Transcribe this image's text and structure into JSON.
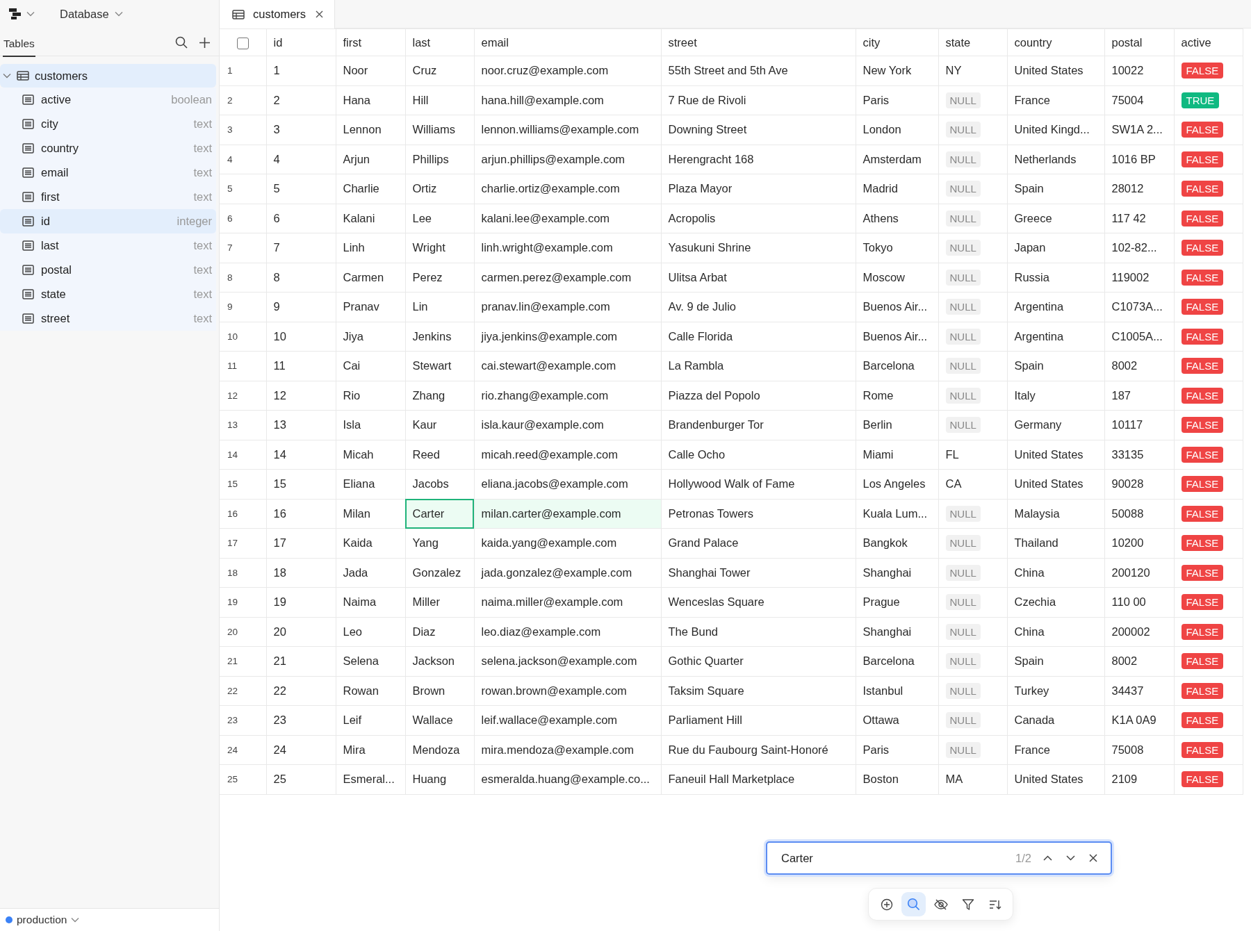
{
  "app": {
    "database_menu": "Database"
  },
  "sidebar": {
    "tabs": [
      {
        "label": "Tables",
        "selected": true
      }
    ],
    "tree": [
      {
        "name": "customers",
        "expanded": true,
        "selected": true,
        "children": [
          {
            "name": "active",
            "type": "boolean",
            "selected": false
          },
          {
            "name": "city",
            "type": "text",
            "selected": false
          },
          {
            "name": "country",
            "type": "text",
            "selected": false
          },
          {
            "name": "email",
            "type": "text",
            "selected": false
          },
          {
            "name": "first",
            "type": "text",
            "selected": false
          },
          {
            "name": "id",
            "type": "integer",
            "selected": true
          },
          {
            "name": "last",
            "type": "text",
            "selected": false
          },
          {
            "name": "postal",
            "type": "text",
            "selected": false
          },
          {
            "name": "state",
            "type": "text",
            "selected": false
          },
          {
            "name": "street",
            "type": "text",
            "selected": false
          }
        ]
      }
    ],
    "connection": {
      "name": "production",
      "color": "#3b82f6"
    }
  },
  "tabs": [
    {
      "label": "customers",
      "selected": true
    }
  ],
  "table": {
    "select_all": {
      "checked": false
    },
    "columns": [
      "id",
      "first",
      "last",
      "email",
      "street",
      "city",
      "state",
      "country",
      "postal",
      "active"
    ],
    "rows": [
      {
        "number": "1",
        "cells": [
          "1",
          "Noor",
          "Cruz",
          "noor.cruz@example.com",
          "55th Street and 5th Ave",
          "New York",
          "NY",
          "United States",
          "10022"
        ],
        "state_null": false,
        "active": {
          "label": "FALSE",
          "value": false
        }
      },
      {
        "number": "2",
        "cells": [
          "2",
          "Hana",
          "Hill",
          "hana.hill@example.com",
          "7 Rue de Rivoli",
          "Paris",
          "NULL",
          "France",
          "75004"
        ],
        "state_null": true,
        "active": {
          "label": "TRUE",
          "value": true
        }
      },
      {
        "number": "3",
        "cells": [
          "3",
          "Lennon",
          "Williams",
          "lennon.williams@example.com",
          "Downing Street",
          "London",
          "NULL",
          "United Kingd...",
          "SW1A 2..."
        ],
        "state_null": true,
        "active": {
          "label": "FALSE",
          "value": false
        }
      },
      {
        "number": "4",
        "cells": [
          "4",
          "Arjun",
          "Phillips",
          "arjun.phillips@example.com",
          "Herengracht 168",
          "Amsterdam",
          "NULL",
          "Netherlands",
          "1016 BP"
        ],
        "state_null": true,
        "active": {
          "label": "FALSE",
          "value": false
        }
      },
      {
        "number": "5",
        "cells": [
          "5",
          "Charlie",
          "Ortiz",
          "charlie.ortiz@example.com",
          "Plaza Mayor",
          "Madrid",
          "NULL",
          "Spain",
          "28012"
        ],
        "state_null": true,
        "active": {
          "label": "FALSE",
          "value": false
        }
      },
      {
        "number": "6",
        "cells": [
          "6",
          "Kalani",
          "Lee",
          "kalani.lee@example.com",
          "Acropolis",
          "Athens",
          "NULL",
          "Greece",
          "117 42"
        ],
        "state_null": true,
        "active": {
          "label": "FALSE",
          "value": false
        }
      },
      {
        "number": "7",
        "cells": [
          "7",
          "Linh",
          "Wright",
          "linh.wright@example.com",
          "Yasukuni Shrine",
          "Tokyo",
          "NULL",
          "Japan",
          "102-82..."
        ],
        "state_null": true,
        "active": {
          "label": "FALSE",
          "value": false
        }
      },
      {
        "number": "8",
        "cells": [
          "8",
          "Carmen",
          "Perez",
          "carmen.perez@example.com",
          "Ulitsa Arbat",
          "Moscow",
          "NULL",
          "Russia",
          "119002"
        ],
        "state_null": true,
        "active": {
          "label": "FALSE",
          "value": false
        }
      },
      {
        "number": "9",
        "cells": [
          "9",
          "Pranav",
          "Lin",
          "pranav.lin@example.com",
          "Av. 9 de Julio",
          "Buenos Air...",
          "NULL",
          "Argentina",
          "C1073A..."
        ],
        "state_null": true,
        "active": {
          "label": "FALSE",
          "value": false
        }
      },
      {
        "number": "10",
        "cells": [
          "10",
          "Jiya",
          "Jenkins",
          "jiya.jenkins@example.com",
          "Calle Florida",
          "Buenos Air...",
          "NULL",
          "Argentina",
          "C1005A..."
        ],
        "state_null": true,
        "active": {
          "label": "FALSE",
          "value": false
        }
      },
      {
        "number": "11",
        "cells": [
          "11",
          "Cai",
          "Stewart",
          "cai.stewart@example.com",
          "La Rambla",
          "Barcelona",
          "NULL",
          "Spain",
          "8002"
        ],
        "state_null": true,
        "active": {
          "label": "FALSE",
          "value": false
        }
      },
      {
        "number": "12",
        "cells": [
          "12",
          "Rio",
          "Zhang",
          "rio.zhang@example.com",
          "Piazza del Popolo",
          "Rome",
          "NULL",
          "Italy",
          "187"
        ],
        "state_null": true,
        "active": {
          "label": "FALSE",
          "value": false
        }
      },
      {
        "number": "13",
        "cells": [
          "13",
          "Isla",
          "Kaur",
          "isla.kaur@example.com",
          "Brandenburger Tor",
          "Berlin",
          "NULL",
          "Germany",
          "10117"
        ],
        "state_null": true,
        "active": {
          "label": "FALSE",
          "value": false
        }
      },
      {
        "number": "14",
        "cells": [
          "14",
          "Micah",
          "Reed",
          "micah.reed@example.com",
          "Calle Ocho",
          "Miami",
          "FL",
          "United States",
          "33135"
        ],
        "state_null": false,
        "active": {
          "label": "FALSE",
          "value": false
        }
      },
      {
        "number": "15",
        "cells": [
          "15",
          "Eliana",
          "Jacobs",
          "eliana.jacobs@example.com",
          "Hollywood Walk of Fame",
          "Los Angeles",
          "CA",
          "United States",
          "90028"
        ],
        "state_null": false,
        "active": {
          "label": "FALSE",
          "value": false
        }
      },
      {
        "number": "16",
        "cells": [
          "16",
          "Milan",
          {
            "text": "Carter",
            "match": true,
            "current": true
          },
          {
            "text": "milan.carter@example.com",
            "match": true,
            "current": false
          },
          "Petronas Towers",
          "Kuala Lum...",
          "NULL",
          "Malaysia",
          "50088"
        ],
        "state_null": true,
        "active": {
          "label": "FALSE",
          "value": false
        }
      },
      {
        "number": "17",
        "cells": [
          "17",
          "Kaida",
          "Yang",
          "kaida.yang@example.com",
          "Grand Palace",
          "Bangkok",
          "NULL",
          "Thailand",
          "10200"
        ],
        "state_null": true,
        "active": {
          "label": "FALSE",
          "value": false
        }
      },
      {
        "number": "18",
        "cells": [
          "18",
          "Jada",
          "Gonzalez",
          "jada.gonzalez@example.com",
          "Shanghai Tower",
          "Shanghai",
          "NULL",
          "China",
          "200120"
        ],
        "state_null": true,
        "active": {
          "label": "FALSE",
          "value": false
        }
      },
      {
        "number": "19",
        "cells": [
          "19",
          "Naima",
          "Miller",
          "naima.miller@example.com",
          "Wenceslas Square",
          "Prague",
          "NULL",
          "Czechia",
          "110 00"
        ],
        "state_null": true,
        "active": {
          "label": "FALSE",
          "value": false
        }
      },
      {
        "number": "20",
        "cells": [
          "20",
          "Leo",
          "Diaz",
          "leo.diaz@example.com",
          "The Bund",
          "Shanghai",
          "NULL",
          "China",
          "200002"
        ],
        "state_null": true,
        "active": {
          "label": "FALSE",
          "value": false
        }
      },
      {
        "number": "21",
        "cells": [
          "21",
          "Selena",
          "Jackson",
          "selena.jackson@example.com",
          "Gothic Quarter",
          "Barcelona",
          "NULL",
          "Spain",
          "8002"
        ],
        "state_null": true,
        "active": {
          "label": "FALSE",
          "value": false
        }
      },
      {
        "number": "22",
        "cells": [
          "22",
          "Rowan",
          "Brown",
          "rowan.brown@example.com",
          "Taksim Square",
          "Istanbul",
          "NULL",
          "Turkey",
          "34437"
        ],
        "state_null": true,
        "active": {
          "label": "FALSE",
          "value": false
        }
      },
      {
        "number": "23",
        "cells": [
          "23",
          "Leif",
          "Wallace",
          "leif.wallace@example.com",
          "Parliament Hill",
          "Ottawa",
          "NULL",
          "Canada",
          "K1A 0A9"
        ],
        "state_null": true,
        "active": {
          "label": "FALSE",
          "value": false
        }
      },
      {
        "number": "24",
        "cells": [
          "24",
          "Mira",
          "Mendoza",
          "mira.mendoza@example.com",
          "Rue du Faubourg Saint-Honoré",
          "Paris",
          "NULL",
          "France",
          "75008"
        ],
        "state_null": true,
        "active": {
          "label": "FALSE",
          "value": false
        }
      },
      {
        "number": "25",
        "cells": [
          "25",
          "Esmeral...",
          "Huang",
          "esmeralda.huang@example.co...",
          "Faneuil Hall Marketplace",
          "Boston",
          "MA",
          "United States",
          "2109"
        ],
        "state_null": false,
        "active": {
          "label": "FALSE",
          "value": false
        }
      }
    ]
  },
  "find": {
    "value": "Carter",
    "count": "1/2"
  },
  "toolbar": [
    {
      "kind": "add",
      "selected": false
    },
    {
      "kind": "search",
      "selected": true
    },
    {
      "kind": "hide",
      "selected": false
    },
    {
      "kind": "filter",
      "selected": false
    },
    {
      "kind": "sort",
      "selected": false
    }
  ]
}
